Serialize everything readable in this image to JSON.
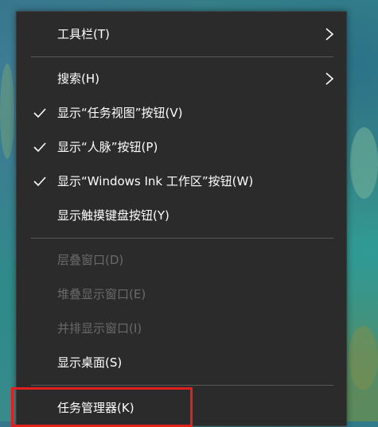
{
  "menu": {
    "items": [
      {
        "label": "工具栏(T)",
        "checked": false,
        "submenu": true,
        "enabled": true
      },
      {
        "label": "搜索(H)",
        "checked": false,
        "submenu": true,
        "enabled": true
      },
      {
        "label": "显示“任务视图”按钮(V)",
        "checked": true,
        "submenu": false,
        "enabled": true
      },
      {
        "label": "显示“人脉”按钮(P)",
        "checked": true,
        "submenu": false,
        "enabled": true
      },
      {
        "label": "显示“Windows Ink 工作区”按钮(W)",
        "checked": true,
        "submenu": false,
        "enabled": true
      },
      {
        "label": "显示触摸键盘按钮(Y)",
        "checked": false,
        "submenu": false,
        "enabled": true
      },
      {
        "label": "层叠窗口(D)",
        "checked": false,
        "submenu": false,
        "enabled": false
      },
      {
        "label": "堆叠显示窗口(E)",
        "checked": false,
        "submenu": false,
        "enabled": false
      },
      {
        "label": "并排显示窗口(I)",
        "checked": false,
        "submenu": false,
        "enabled": false
      },
      {
        "label": "显示桌面(S)",
        "checked": false,
        "submenu": false,
        "enabled": true
      },
      {
        "label": "任务管理器(K)",
        "checked": false,
        "submenu": false,
        "enabled": true
      }
    ]
  },
  "icons": {
    "check": "check-icon",
    "submenu_arrow": "chevron-right-icon"
  },
  "colors": {
    "menu_background": "#2b2b2b",
    "text": "#ffffff",
    "disabled_text": "#6a6a6a",
    "separator": "#575757",
    "highlight_box": "#e01f1f"
  }
}
